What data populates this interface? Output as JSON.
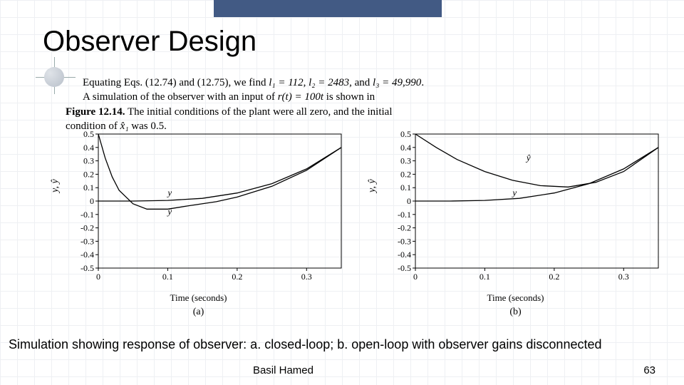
{
  "slide": {
    "title": "Observer Design",
    "caption": "Simulation showing response of observer: a. closed-loop; b. open-loop with observer gains disconnected",
    "author": "Basil Hamed",
    "page": "63"
  },
  "body": {
    "line1_pre": "Equating Eqs. (12.74) and (12.75), we find ",
    "l1": "l₁ = 112",
    "l2": "l₂ = 2483",
    "l3": "l₃ = 49,990",
    "line2_pre": "A simulation of the observer with an input of ",
    "rt": "r(t) = 100t",
    "line2_post": " is shown in",
    "line3a": "Figure 12.14.",
    "line3b": " The initial conditions of the plant were all zero, and the initial",
    "line4a": "condition of ",
    "xhat": "x̂₁",
    "line4b": " was 0.5."
  },
  "chart_data": [
    {
      "type": "line",
      "title": "",
      "xlabel": "Time (seconds)",
      "ylabel": "y, ŷ",
      "sublabel": "(a)",
      "xlim": [
        0,
        0.35
      ],
      "ylim": [
        -0.5,
        0.5
      ],
      "xticks": [
        0,
        0.1,
        0.2,
        0.3
      ],
      "yticks": [
        -0.5,
        -0.4,
        -0.3,
        -0.2,
        -0.1,
        0,
        0.1,
        0.2,
        0.3,
        0.4,
        0.5
      ],
      "series": [
        {
          "name": "y",
          "x": [
            0,
            0.02,
            0.05,
            0.1,
            0.15,
            0.2,
            0.25,
            0.3,
            0.35
          ],
          "y": [
            0,
            0.0,
            0.0,
            0.005,
            0.02,
            0.06,
            0.13,
            0.24,
            0.4
          ]
        },
        {
          "name": "ŷ",
          "x": [
            0,
            0.01,
            0.02,
            0.03,
            0.05,
            0.07,
            0.1,
            0.13,
            0.17,
            0.2,
            0.25,
            0.3,
            0.35
          ],
          "y": [
            0.5,
            0.32,
            0.18,
            0.08,
            -0.02,
            -0.06,
            -0.06,
            -0.035,
            -0.005,
            0.03,
            0.11,
            0.23,
            0.4
          ]
        }
      ],
      "annotations": [
        {
          "label": "y",
          "x": 0.1,
          "y": 0.04
        },
        {
          "label": "ŷ",
          "x": 0.1,
          "y": -0.1
        }
      ]
    },
    {
      "type": "line",
      "title": "",
      "xlabel": "Time (seconds)",
      "ylabel": "y, ŷ",
      "sublabel": "(b)",
      "xlim": [
        0,
        0.35
      ],
      "ylim": [
        -0.5,
        0.5
      ],
      "xticks": [
        0,
        0.1,
        0.2,
        0.3
      ],
      "yticks": [
        -0.5,
        -0.4,
        -0.3,
        -0.2,
        -0.1,
        0,
        0.1,
        0.2,
        0.3,
        0.4,
        0.5
      ],
      "series": [
        {
          "name": "y",
          "x": [
            0,
            0.05,
            0.1,
            0.15,
            0.2,
            0.25,
            0.3,
            0.35
          ],
          "y": [
            0,
            0.0,
            0.005,
            0.02,
            0.06,
            0.13,
            0.24,
            0.4
          ]
        },
        {
          "name": "ŷ",
          "x": [
            0,
            0.03,
            0.06,
            0.1,
            0.14,
            0.18,
            0.22,
            0.26,
            0.3,
            0.35
          ],
          "y": [
            0.5,
            0.4,
            0.31,
            0.22,
            0.155,
            0.115,
            0.105,
            0.14,
            0.22,
            0.4
          ]
        }
      ],
      "annotations": [
        {
          "label": "ŷ",
          "x": 0.16,
          "y": 0.3
        },
        {
          "label": "y",
          "x": 0.14,
          "y": 0.04
        }
      ]
    }
  ]
}
